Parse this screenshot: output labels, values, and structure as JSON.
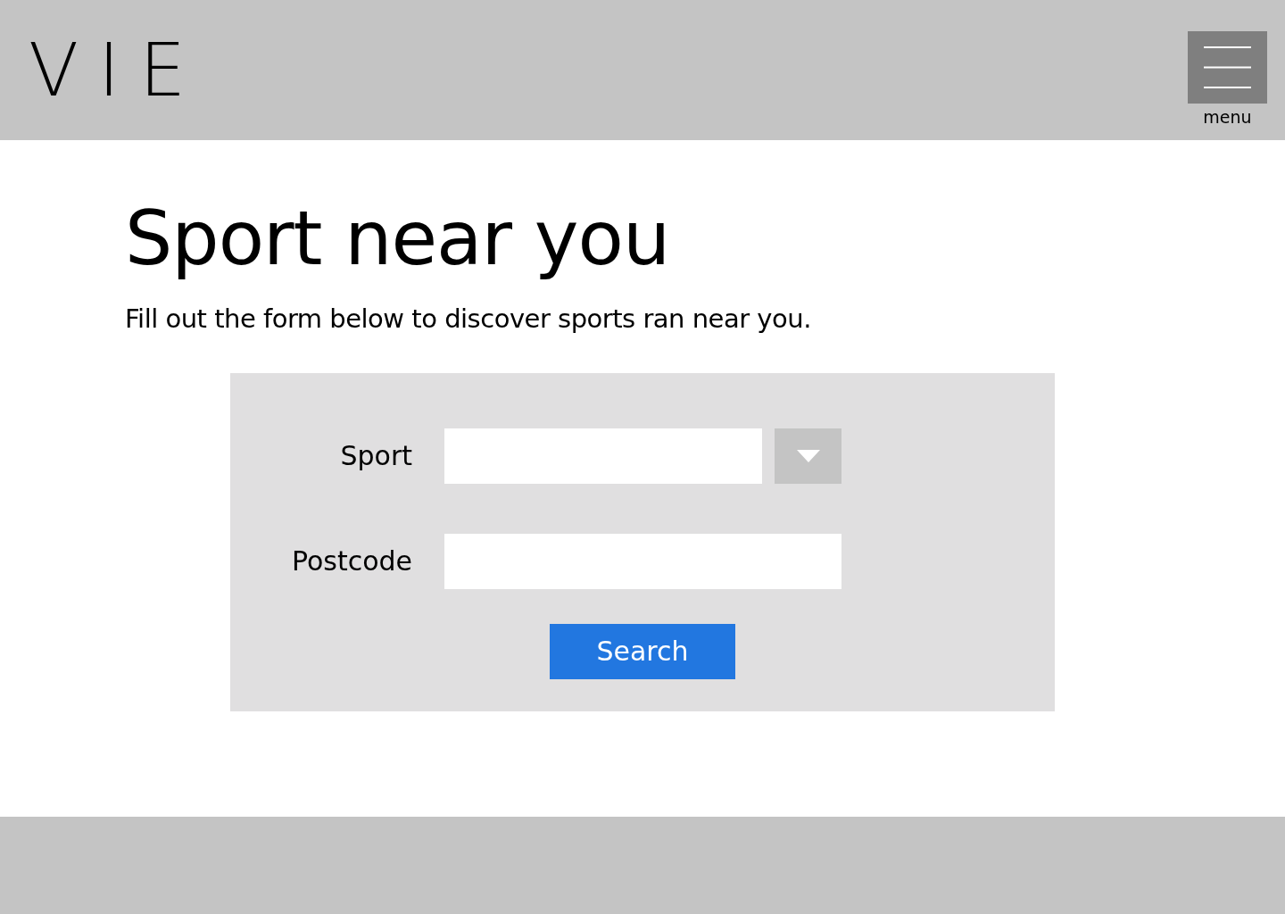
{
  "header": {
    "logo": "VIE",
    "menu_button": {
      "label": "menu"
    }
  },
  "main": {
    "title": "Sport near you",
    "intro": "Fill out the form below to discover sports ran near you."
  },
  "form": {
    "fields": [
      {
        "label": "Sport",
        "kind": "select"
      },
      {
        "label": "Postcode",
        "kind": "text"
      }
    ],
    "submit": "Search"
  }
}
